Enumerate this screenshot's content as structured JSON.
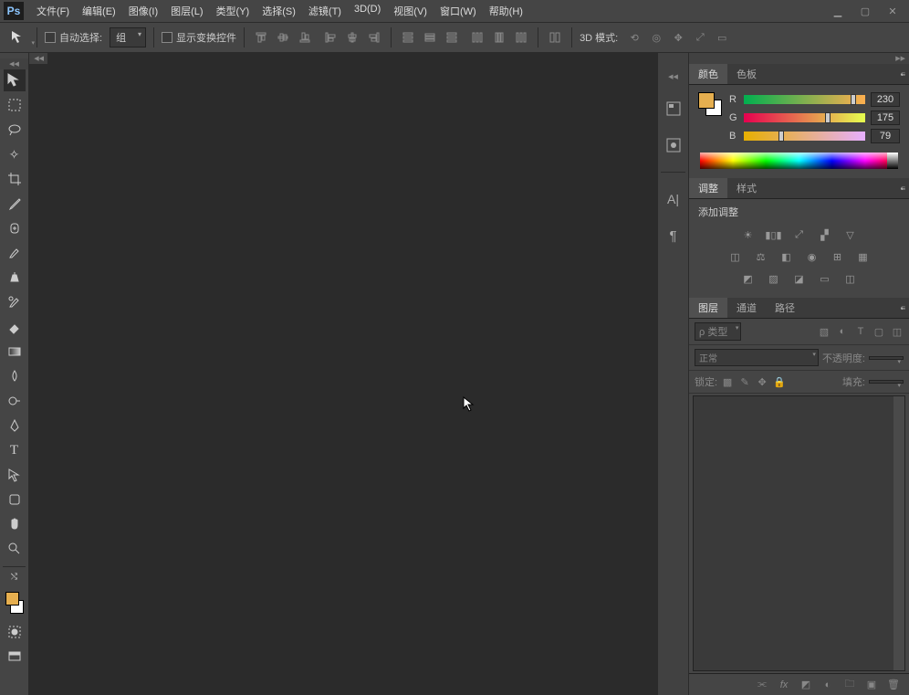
{
  "app": {
    "logo": "Ps"
  },
  "menu": [
    "文件(F)",
    "编辑(E)",
    "图像(I)",
    "图层(L)",
    "类型(Y)",
    "选择(S)",
    "滤镜(T)",
    "3D(D)",
    "视图(V)",
    "窗口(W)",
    "帮助(H)"
  ],
  "options": {
    "autoSelect": "自动选择:",
    "group": "组",
    "showTransform": "显示变换控件",
    "mode3d": "3D 模式:"
  },
  "panels": {
    "color": {
      "tabs": [
        "颜色",
        "色板"
      ],
      "active": 0
    },
    "adjust": {
      "tabs": [
        "调整",
        "样式"
      ],
      "active": 0,
      "label": "添加调整"
    },
    "layers": {
      "tabs": [
        "图层",
        "通道",
        "路径"
      ],
      "active": 0,
      "kind": "类型",
      "blend": "正常",
      "opacityLabel": "不透明度:",
      "lockLabel": "锁定:",
      "fillLabel": "填充:"
    }
  },
  "color": {
    "r": {
      "label": "R",
      "value": "230",
      "pct": 90
    },
    "g": {
      "label": "G",
      "value": "175",
      "pct": 69
    },
    "b": {
      "label": "B",
      "value": "79",
      "pct": 31
    }
  }
}
